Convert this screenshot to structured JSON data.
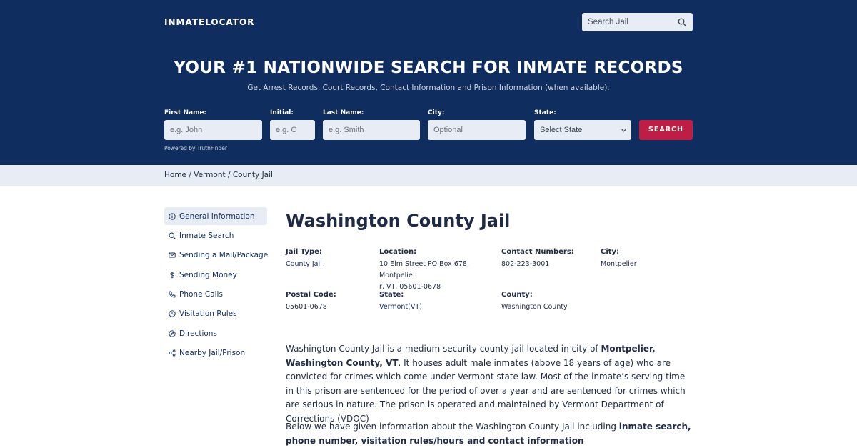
{
  "header": {
    "logo": "INMATELOCATOR",
    "search_placeholder": "Search Jail"
  },
  "hero": {
    "title": "YOUR #1 NATIONWIDE SEARCH FOR INMATE RECORDS",
    "subtitle": "Get Arrest Records, Court Records, Contact Information and Prison Information (when available)."
  },
  "form": {
    "first_name_label": "First Name:",
    "first_name_placeholder": "e.g. John",
    "initial_label": "Initial:",
    "initial_placeholder": "e.g. C",
    "last_name_label": "Last Name:",
    "last_name_placeholder": "e.g. Smith",
    "city_label": "City:",
    "city_placeholder": "Optional",
    "state_label": "State:",
    "state_value": "Select State",
    "search_label": "SEARCH",
    "powered_by": "Powered by TruthFinder"
  },
  "breadcrumb": {
    "home": "Home",
    "sep1": " / ",
    "state": "Vermont",
    "sep2": " / ",
    "current": "County Jail"
  },
  "sidebar": {
    "items": [
      {
        "label": "General Information",
        "icon": "info-icon"
      },
      {
        "label": "Inmate Search",
        "icon": "search-icon"
      },
      {
        "label": "Sending a Mail/Package",
        "icon": "mail-icon"
      },
      {
        "label": "Sending Money",
        "icon": "dollar-icon"
      },
      {
        "label": "Phone Calls",
        "icon": "phone-icon"
      },
      {
        "label": "Visitation Rules",
        "icon": "clock-icon"
      },
      {
        "label": "Directions",
        "icon": "compass-icon"
      },
      {
        "label": "Nearby Jail/Prison",
        "icon": "share-icon"
      }
    ]
  },
  "main": {
    "title": "Washington County Jail",
    "info": {
      "jail_type_label": "Jail Type:",
      "jail_type_value": "County Jail",
      "location_label": "Location:",
      "location_value_line1": "10 Elm Street PO Box 678, Montpelie",
      "location_value_line2": "r, VT, 05601-0678",
      "contact_label": "Contact Numbers:",
      "contact_value": "802-223-3001",
      "city_label": "City:",
      "city_value": "Montpelier",
      "postal_label": "Postal Code:",
      "postal_value": "05601-0678",
      "state_label": "State:",
      "state_value": "Vermont(VT)",
      "county_label": "County:",
      "county_value": "Washington County"
    },
    "desc1": {
      "part1": "Washington County Jail is a medium security county jail located in city of ",
      "bold1": "Montpelier, Washington County, VT",
      "part2": ". It houses adult male inmates (above 18 years of age) who are convicted for crimes which come under Vermont state law. Most of the inmate’s serving time in this prison are sentenced for the period of over a year and are sentenced for crimes which are serious in nature. The prison is operated and maintained by Vermont Department of Corrections (VDOC)"
    },
    "desc2": {
      "part1": "Below we have given information about the Washington County Jail including ",
      "bold1": "inmate search, phone number, visitation rules/hours and contact information"
    }
  },
  "colors": {
    "hero_bg": "#0f2d5e",
    "accent": "#be1e44",
    "input_bg": "#e8edf5",
    "text": "#1f2a44"
  }
}
